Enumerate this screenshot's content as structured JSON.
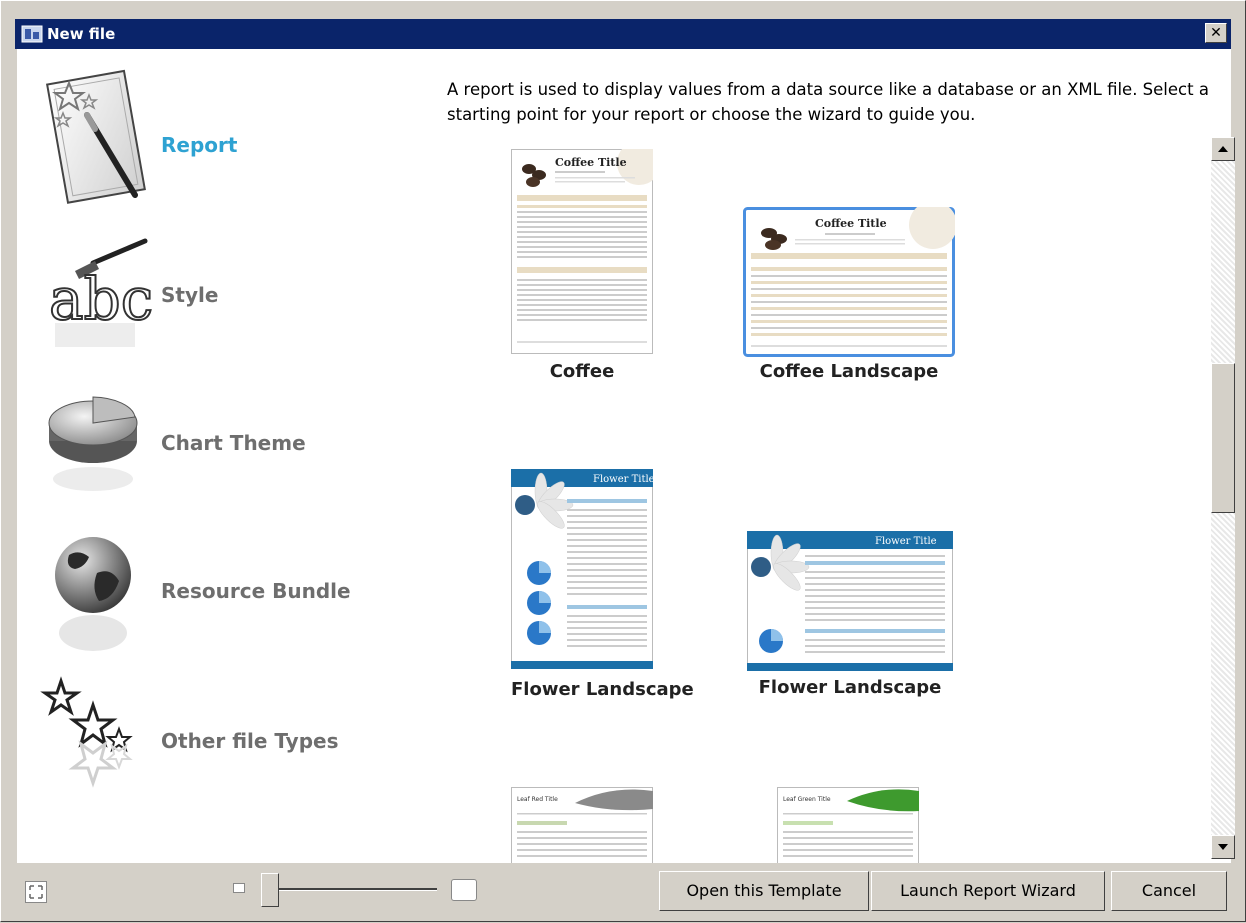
{
  "window": {
    "title": "New file",
    "close_label": "✕"
  },
  "categories": [
    {
      "label": "Report",
      "icon": "report-pen-icon",
      "active": true
    },
    {
      "label": "Style",
      "icon": "style-brush-icon",
      "active": false
    },
    {
      "label": "Chart Theme",
      "icon": "pie-chart-icon",
      "active": false
    },
    {
      "label": "Resource Bundle",
      "icon": "globe-icon",
      "active": false
    },
    {
      "label": "Other file Types",
      "icon": "stars-icon",
      "active": false
    }
  ],
  "description": "A report is used to display values from a data source like a database or an XML file. Select a starting point for your report or choose the wizard to guide you.",
  "templates": [
    {
      "label": "Coffee",
      "title": "Coffee Title",
      "selected": false
    },
    {
      "label": "Coffee Landscape",
      "title": "Coffee Title",
      "selected": true
    },
    {
      "label": "Flower",
      "title": "Flower Title",
      "selected": false
    },
    {
      "label": "Flower Landscape",
      "title": "Flower Title",
      "selected": false
    },
    {
      "label": "",
      "title": "Leaf Red Title",
      "selected": false
    },
    {
      "label": "",
      "title": "Leaf Green Title",
      "selected": false
    }
  ],
  "buttons": {
    "open_template": "Open this Template",
    "launch_wizard": "Launch Report Wizard",
    "cancel": "Cancel"
  },
  "colors": {
    "accent": "#2ea2d2",
    "titlebar": "#0a246a",
    "selection": "#4a8fe0"
  }
}
